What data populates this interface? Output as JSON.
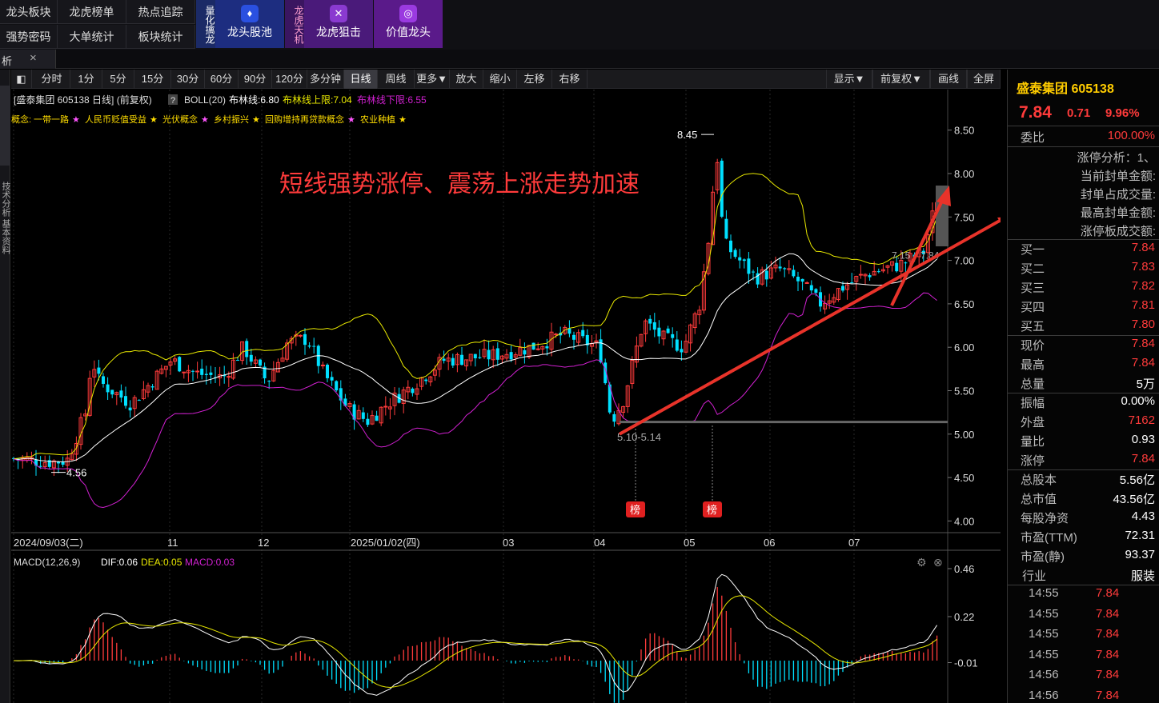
{
  "nav": {
    "grid": [
      {
        "label": "龙头板块"
      },
      {
        "label": "龙虎榜单"
      },
      {
        "label": "热点追踪"
      },
      {
        "label": "强势密码"
      },
      {
        "label": "大单统计"
      },
      {
        "label": "板块统计"
      }
    ],
    "vert1": "量化擒龙",
    "btn1": "龙头股池",
    "vert2": "龙虎天机",
    "btn2": "龙虎狙击",
    "btn3": "价值龙头"
  },
  "tabbar": {
    "tab_label": "析",
    "close": "×"
  },
  "toolbar": {
    "periods": [
      "分时",
      "1分",
      "5分",
      "15分",
      "30分",
      "60分",
      "90分",
      "120分",
      "多分钟",
      "日线",
      "周线",
      "更多▼",
      "放大",
      "缩小",
      "左移",
      "右移"
    ],
    "active": "日线",
    "right": [
      "显示▼",
      "前复权▼",
      "画线",
      "全屏"
    ]
  },
  "left_strip": {
    "text": "技术分析 基本资料"
  },
  "chart": {
    "info_main": "[盛泰集团 605138 日线] (前复权)",
    "boll_label": "BOLL(20)",
    "boll_mid": "布林线:6.80",
    "boll_up": "布林线上限:7.04",
    "boll_low": "布林线下限:6.55",
    "concepts_label": "概念:",
    "concepts": [
      "一带一路",
      "人民币贬值受益",
      "光伏概念",
      "乡村振兴",
      "回购增持再贷款概念",
      "农业种植"
    ],
    "annotation": "短线强势涨停、震荡上涨走势加速",
    "price_ticks": [
      "8.50",
      "8.00",
      "7.50",
      "7.00",
      "6.50",
      "6.00",
      "5.50",
      "5.00",
      "4.50",
      "4.00"
    ],
    "date_labels": [
      "2024/09/03(二)",
      "11",
      "12",
      "2025/01/02(四)",
      "03",
      "04",
      "05",
      "06",
      "07"
    ],
    "marks": {
      "high": "8.45",
      "low_start": "4.56",
      "range": "5.10-5.14",
      "recent": "7.15",
      "recent2": "7.84",
      "bang": "榜"
    },
    "macd_label": "MACD(12,26,9)",
    "dif": "DIF:0.06",
    "dea": "DEA:0.05",
    "macd": "MACD:0.03",
    "macd_ticks": [
      "0.46",
      "0.22",
      "-0.01"
    ],
    "colors": {
      "up": "#ff3b3b",
      "down": "#00e0ff",
      "mid": "#ffffff",
      "upper": "#e8e800",
      "lower": "#d020d0",
      "arrow": "#e8332a"
    }
  },
  "chart_data": {
    "type": "candlestick",
    "title": "盛泰集团 605138 日线",
    "ylim": [
      4.0,
      8.6
    ],
    "x_range": [
      "2024/09/03",
      "2025/07"
    ],
    "key_points": [
      {
        "label": "low",
        "value": 4.56
      },
      {
        "label": "high",
        "value": 8.45
      },
      {
        "label": "range",
        "value": "5.10-5.14"
      },
      {
        "label": "last",
        "value": 7.84
      }
    ]
  },
  "stock": {
    "name": "盛泰集团 605138",
    "price": "7.84",
    "change": "0.71",
    "pct": "9.96%",
    "weibi_label": "委比",
    "weibi": "100.00%",
    "limit_lines": [
      "涨停分析：1、",
      "当前封单金额:",
      "封单占成交量:",
      "最高封单金额:",
      "涨停板成交额:"
    ],
    "orderbook": [
      {
        "label": "买一",
        "value": "7.84"
      },
      {
        "label": "买二",
        "value": "7.83"
      },
      {
        "label": "买三",
        "value": "7.82"
      },
      {
        "label": "买四",
        "value": "7.81"
      },
      {
        "label": "买五",
        "value": "7.80"
      }
    ],
    "stats": [
      {
        "label": "现价",
        "value": "7.84",
        "color": "red"
      },
      {
        "label": "最高",
        "value": "7.84",
        "color": "red"
      },
      {
        "label": "总量",
        "value": "5万",
        "color": "white"
      },
      {
        "label": "振幅",
        "value": "0.00%",
        "color": "white"
      },
      {
        "label": "外盘",
        "value": "7162",
        "color": "red"
      },
      {
        "label": "量比",
        "value": "0.93",
        "color": "white"
      },
      {
        "label": "涨停",
        "value": "7.84",
        "color": "red"
      }
    ],
    "fundamentals": [
      {
        "label": "总股本",
        "value": "5.56亿"
      },
      {
        "label": "总市值",
        "value": "43.56亿"
      },
      {
        "label": "每股净资",
        "value": "4.43"
      },
      {
        "label": "市盈(TTM)",
        "value": "72.31"
      },
      {
        "label": "市盈(静)",
        "value": "93.37"
      }
    ],
    "industry_label": "行业",
    "industry": "服装",
    "ticks": [
      {
        "time": "14:55",
        "price": "7.84"
      },
      {
        "time": "14:55",
        "price": "7.84"
      },
      {
        "time": "14:55",
        "price": "7.84"
      },
      {
        "time": "14:55",
        "price": "7.84"
      },
      {
        "time": "14:56",
        "price": "7.84"
      },
      {
        "time": "14:56",
        "price": "7.84"
      }
    ]
  }
}
